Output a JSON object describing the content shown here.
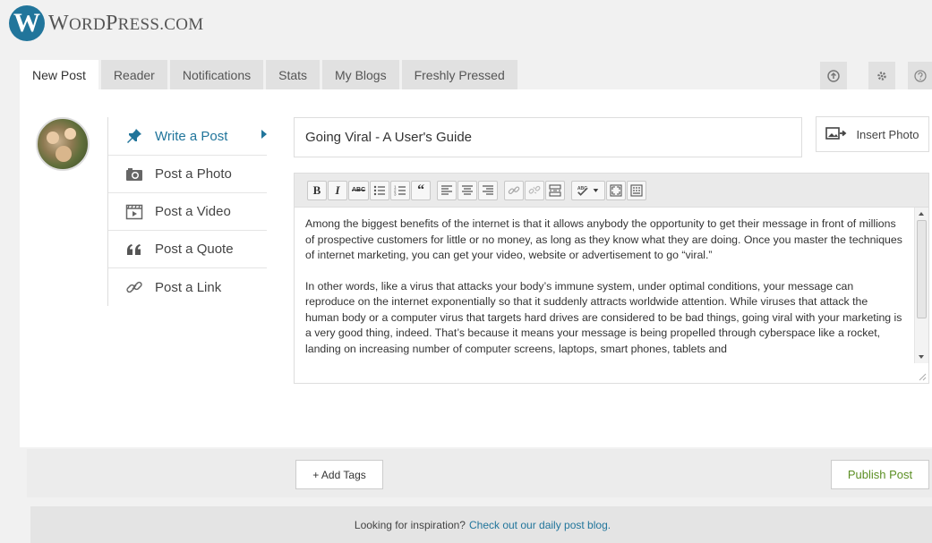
{
  "brand": {
    "logo_letter": "W",
    "name_big1": "W",
    "name_small1": "ORD",
    "name_big2": "P",
    "name_small2": "RESS.COM"
  },
  "tabs": [
    {
      "label": "New Post"
    },
    {
      "label": "Reader"
    },
    {
      "label": "Notifications"
    },
    {
      "label": "Stats"
    },
    {
      "label": "My Blogs"
    },
    {
      "label": "Freshly Pressed"
    }
  ],
  "header_icons": [
    "upload-icon",
    "gear-icon",
    "help-icon"
  ],
  "menu": [
    {
      "label": "Write a Post",
      "icon": "pushpin-icon"
    },
    {
      "label": "Post a Photo",
      "icon": "camera-icon"
    },
    {
      "label": "Post a Video",
      "icon": "film-icon"
    },
    {
      "label": "Post a Quote",
      "icon": "quote-icon"
    },
    {
      "label": "Post a Link",
      "icon": "link-icon"
    }
  ],
  "post": {
    "title": "Going Viral - A User's Guide",
    "paragraphs": [
      "Among the biggest benefits of the internet is that it allows anybody the opportunity to get their message in front of millions of prospective customers for little or no money, as long as they know what they are doing. Once you master the techniques of internet marketing, you can get your video, website or advertisement to go “viral.”",
      "In other words, like a virus that attacks your body’s immune system, under optimal conditions, your message can reproduce on the internet exponentially so that it suddenly attracts worldwide attention. While viruses that attack the human body or a computer virus that targets hard drives are considered to be bad things, going viral with your marketing is a very good thing, indeed. That’s because it means your message is being propelled through cyberspace like a rocket, landing on increasing number of computer screens, laptops, smart phones, tablets and"
    ]
  },
  "buttons": {
    "insert_photo": "Insert Photo",
    "add_tags": "+ Add Tags",
    "publish": "Publish Post"
  },
  "toolbar": {
    "bold": "B",
    "italic": "I",
    "strike": "ABC",
    "quote": "“"
  },
  "footer": {
    "inspiration_text": "Looking for inspiration?",
    "inspiration_link": "Check out our daily post blog."
  },
  "colors": {
    "accent": "#21759b",
    "publish": "#5b8f23",
    "background": "#f1f1f1"
  }
}
